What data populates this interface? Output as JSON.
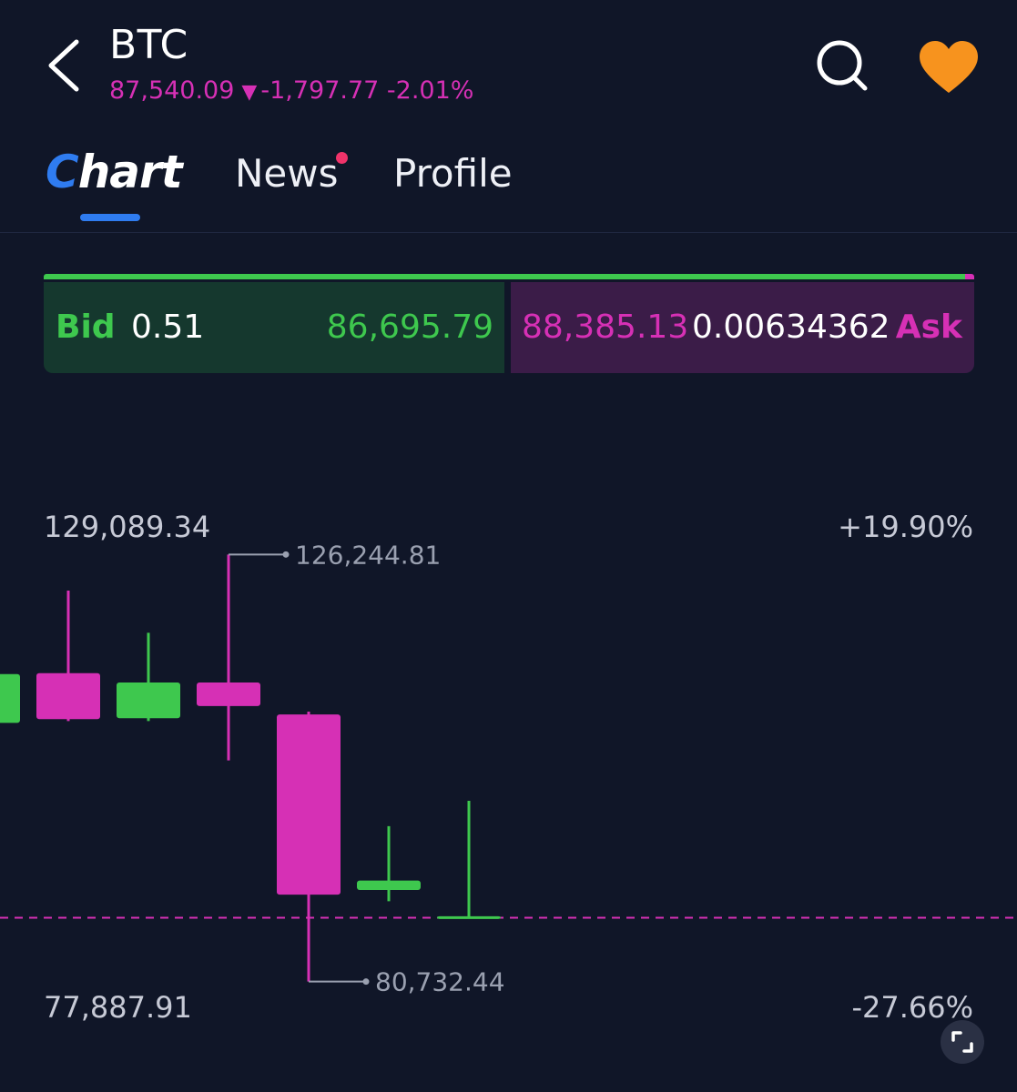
{
  "header": {
    "symbol": "BTC",
    "price": "87,540.09",
    "change_arrow": "▼",
    "change_value": "-1,797.77",
    "change_percent": "-2.01%"
  },
  "icons": {
    "back": "chevron-left-icon",
    "search": "search-icon",
    "favorite": "heart-icon",
    "fullscreen": "fullscreen-icon"
  },
  "tabs": {
    "chart_first": "C",
    "chart_rest": "hart",
    "news": "News",
    "profile": "Profile",
    "active": "Chart",
    "news_has_notification": true
  },
  "orderbook": {
    "bid_label": "Bid",
    "bid_qty": "0.51",
    "bid_price": "86,695.79",
    "ask_price": "88,385.13",
    "ask_qty": "0.00634362",
    "ask_label": "Ask",
    "bid_share": 0.99
  },
  "colors": {
    "background": "#101628",
    "up": "#3ec84e",
    "down": "#d630b5",
    "accent": "#2f7cf0",
    "favorite": "#f7931e",
    "notification": "#f0336a"
  },
  "chart_data": {
    "type": "candlestick",
    "y_max_label": "129,089.34",
    "y_min_label": "77,887.91",
    "pct_max_label": "+19.90%",
    "pct_min_label": "-27.66%",
    "ylim": [
      77887.91,
      129089.34
    ],
    "current_price": 87540.09,
    "high_marker": {
      "label": "126,244.81",
      "value": 126244.81
    },
    "low_marker": {
      "label": "80,732.44",
      "value": 80732.44
    },
    "candles": [
      {
        "open": 108300,
        "close": 113500,
        "high": 113500,
        "low": 108300,
        "dir": "up"
      },
      {
        "open": 113600,
        "close": 108700,
        "high": 122400,
        "low": 108500,
        "dir": "down"
      },
      {
        "open": 108800,
        "close": 112600,
        "high": 117900,
        "low": 108500,
        "dir": "up"
      },
      {
        "open": 112600,
        "close": 110100,
        "high": 126244.81,
        "low": 104300,
        "dir": "down"
      },
      {
        "open": 109200,
        "close": 90000,
        "high": 109500,
        "low": 80732.44,
        "dir": "down"
      },
      {
        "open": 90500,
        "close": 91500,
        "high": 97300,
        "low": 89300,
        "dir": "up"
      },
      {
        "open": 87500,
        "close": 87700,
        "high": 100000,
        "low": 87500,
        "dir": "up"
      }
    ]
  }
}
